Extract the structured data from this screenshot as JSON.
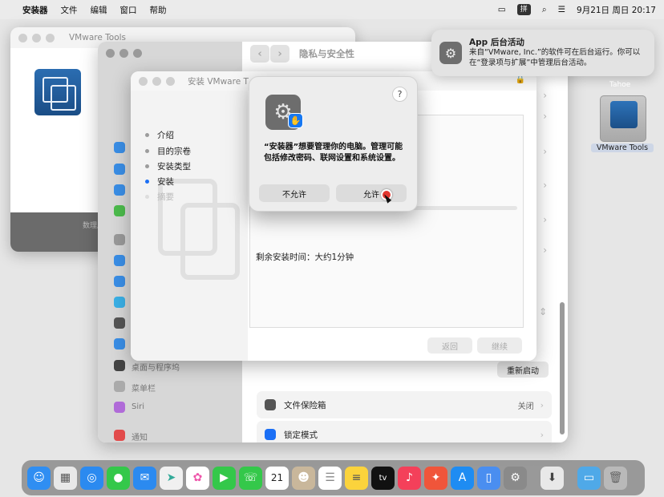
{
  "menubar": {
    "apple_icon": "apple-logo",
    "app_name": "安装器",
    "items": [
      "文件",
      "编辑",
      "窗口",
      "帮助"
    ],
    "ime_badge": "拼",
    "date_time": "9月21日 周日 20:17"
  },
  "back_window": {
    "title": "VMware Tools",
    "footer_text": "数理局（"
  },
  "settings_window": {
    "title": "隐私与安全性",
    "sidebar_items": [
      "桌面与程序坞",
      "菜单栏",
      "Siri",
      "通知"
    ],
    "restart_button": "重新启动",
    "rows": [
      {
        "label": "文件保险箱",
        "value": "关闭"
      },
      {
        "label": "锁定模式",
        "value": ""
      }
    ]
  },
  "installer": {
    "title": "安装 VMware T",
    "steps": [
      {
        "label": "介绍",
        "state": "done"
      },
      {
        "label": "目的宗卷",
        "state": "done"
      },
      {
        "label": "安装类型",
        "state": "done"
      },
      {
        "label": "安装",
        "state": "active"
      },
      {
        "label": "摘要",
        "state": "pending"
      }
    ],
    "eta_text": "剩余安装时间：大约1分钟",
    "back_button": "返回",
    "continue_button": "继续"
  },
  "dialog": {
    "help_label": "?",
    "message": "“安装器”想要管理你的电脑。管理可能包括修改密码、联网设置和系统设置。",
    "deny_button": "不允许",
    "allow_button": "允许"
  },
  "notification": {
    "title": "App 后台活动",
    "body": "来自“VMware, Inc.”的软件可在后台运行。你可以在“登录项与扩展”中管理后台活动。"
  },
  "desktop": {
    "volume_label": "VMware Tools",
    "other_label": "Tahoe"
  },
  "dock": {
    "calendar_day": "21",
    "tv_label": "tv"
  },
  "colors": {
    "accent": "#1b6ff5",
    "dialog_bg": "#ededed",
    "vmware_blue": "#1a4d86"
  }
}
